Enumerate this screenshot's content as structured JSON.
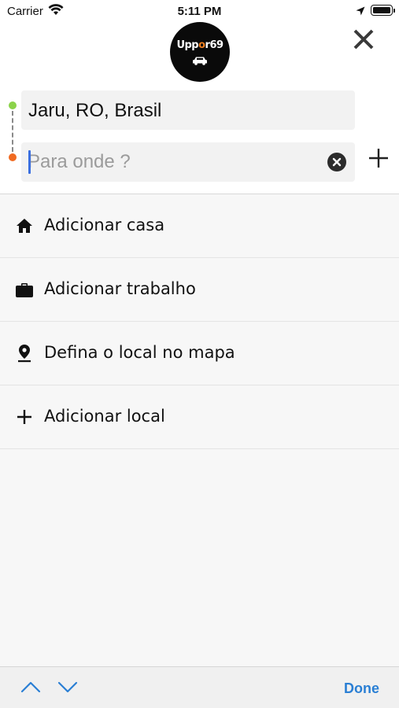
{
  "status_bar": {
    "carrier": "Carrier",
    "time": "5:11 PM",
    "icons": [
      "wifi-icon",
      "location-arrow-icon",
      "battery-icon"
    ]
  },
  "header": {
    "logo_text_main": "Upp",
    "logo_text_accent": "r69",
    "logo_text_o": "o",
    "close_icon": "close-icon"
  },
  "route": {
    "origin_value": "Jaru, RO, Brasil",
    "destination_placeholder": "Para onde ?",
    "destination_value": "",
    "clear_icon": "clear-circle-icon",
    "add_stop_icon": "plus-icon"
  },
  "options": [
    {
      "icon": "home-icon",
      "label": "Adicionar casa"
    },
    {
      "icon": "briefcase-icon",
      "label": "Adicionar trabalho"
    },
    {
      "icon": "map-pin-icon",
      "label": "Defina o local no mapa"
    },
    {
      "icon": "plus-icon",
      "label": "Adicionar local"
    }
  ],
  "keyboard_toolbar": {
    "done_label": "Done",
    "icons": [
      "chevron-up-icon",
      "chevron-down-icon"
    ]
  },
  "colors": {
    "origin_dot": "#8bd34a",
    "destination_dot": "#f06b22",
    "accent": "#2a7fd4",
    "logo_accent": "#f07f1f"
  }
}
